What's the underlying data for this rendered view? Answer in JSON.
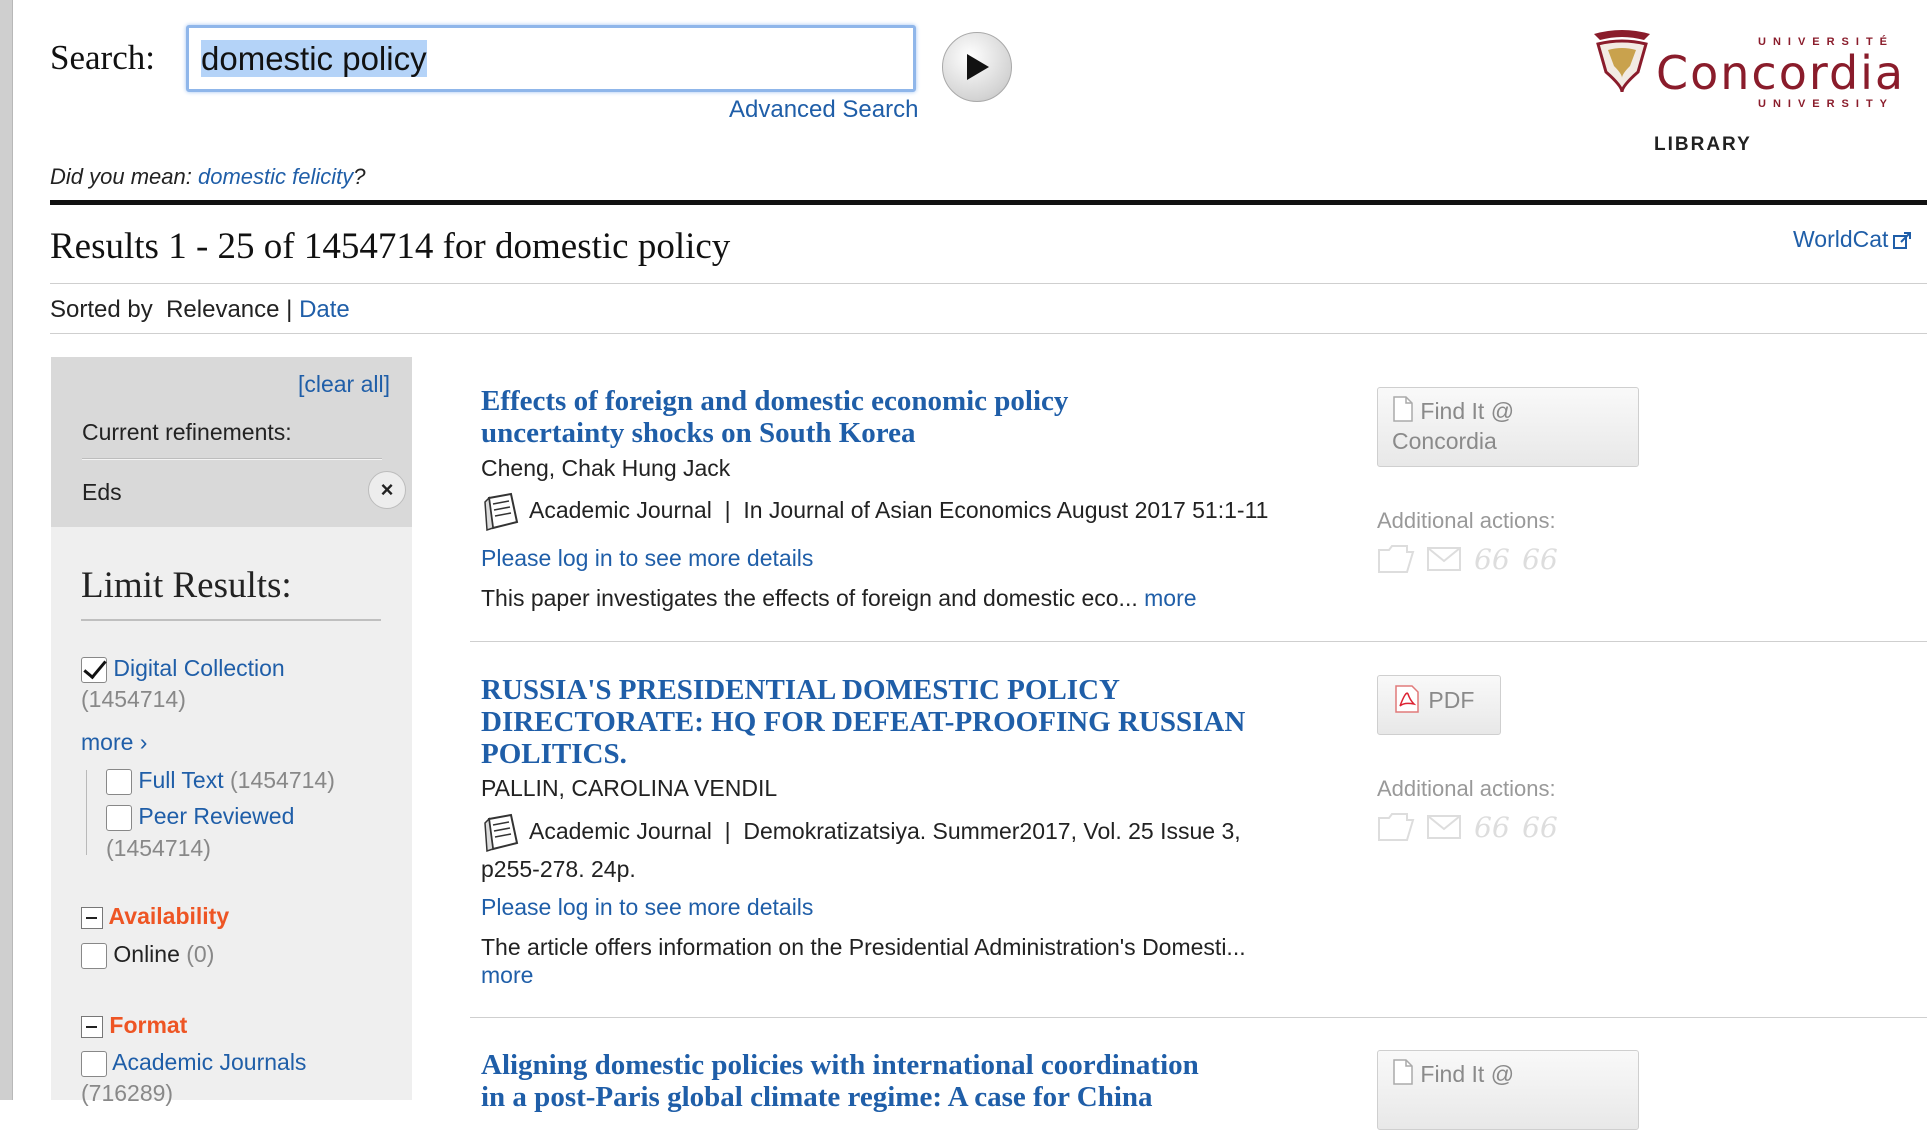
{
  "header": {
    "search_label": "Search:",
    "search_value": "domestic policy",
    "advanced_search": "Advanced Search",
    "logo": {
      "top_text": "UNIVERSITÉ",
      "name": "Concordia",
      "bottom_text": "UNIVERSITY",
      "library": "LIBRARY"
    }
  },
  "suggestion": {
    "prefix": "Did you mean: ",
    "term": "domestic felicity",
    "suffix": "?"
  },
  "results_header": {
    "title": "Results 1 - 25 of 1454714 for domestic policy",
    "worldcat": "WorldCat"
  },
  "sort": {
    "label": "Sorted by",
    "current": "Relevance",
    "separator": "|",
    "alt": "Date"
  },
  "sidebar": {
    "clear_all": "[clear all]",
    "current_refinements": "Current refinements:",
    "refinement": "Eds",
    "remove_icon": "×",
    "limit_title": "Limit Results:",
    "digital_collection": {
      "label": "Digital Collection",
      "count": "(1454714)",
      "checked": true
    },
    "more": "more ›",
    "full_text": {
      "label": "Full Text",
      "count": "(1454714)"
    },
    "peer_reviewed": {
      "label": "Peer Reviewed",
      "count": "(1454714)"
    },
    "availability": {
      "heading": "Availability",
      "online_label": "Online",
      "online_count": "(0)"
    },
    "format": {
      "heading": "Format",
      "academic_label": "Academic Journals",
      "academic_count": "(716289)"
    }
  },
  "results": [
    {
      "title_line1": "Effects of foreign and domestic economic policy",
      "title_line2": "uncertainty shocks on South Korea",
      "author": "Cheng, Chak Hung Jack",
      "type": "Academic Journal",
      "source": "In Journal of Asian Economics August 2017 51:1-11",
      "login": "Please log in to see more details",
      "abstract": "This paper investigates the effects of foreign and domestic eco...",
      "more": "more",
      "button": "Find It @ Concordia",
      "additional": "Additional actions:"
    },
    {
      "title_line1": "RUSSIA'S PRESIDENTIAL DOMESTIC POLICY",
      "title_line2": "DIRECTORATE: HQ FOR DEFEAT-PROOFING RUSSIAN",
      "title_line3": "POLITICS.",
      "author": "PALLIN, CAROLINA VENDIL",
      "type": "Academic Journal",
      "source": "Demokratizatsiya. Summer2017, Vol. 25 Issue 3,",
      "source2": "p255-278. 24p.",
      "login": "Please log in to see more details",
      "abstract": "The article offers information on the Presidential Administration's Domesti...",
      "more": "more",
      "button": "PDF",
      "additional": "Additional actions:"
    },
    {
      "title_line1": "Aligning domestic policies with international coordination",
      "title_line2": "in a post-Paris global climate regime: A case for China",
      "button": "Find It @"
    }
  ],
  "actions": {
    "quote": "66"
  },
  "colors": {
    "link": "#1f5ea8",
    "facet_heading": "#ee5524",
    "brand": "#8a1c2b"
  }
}
